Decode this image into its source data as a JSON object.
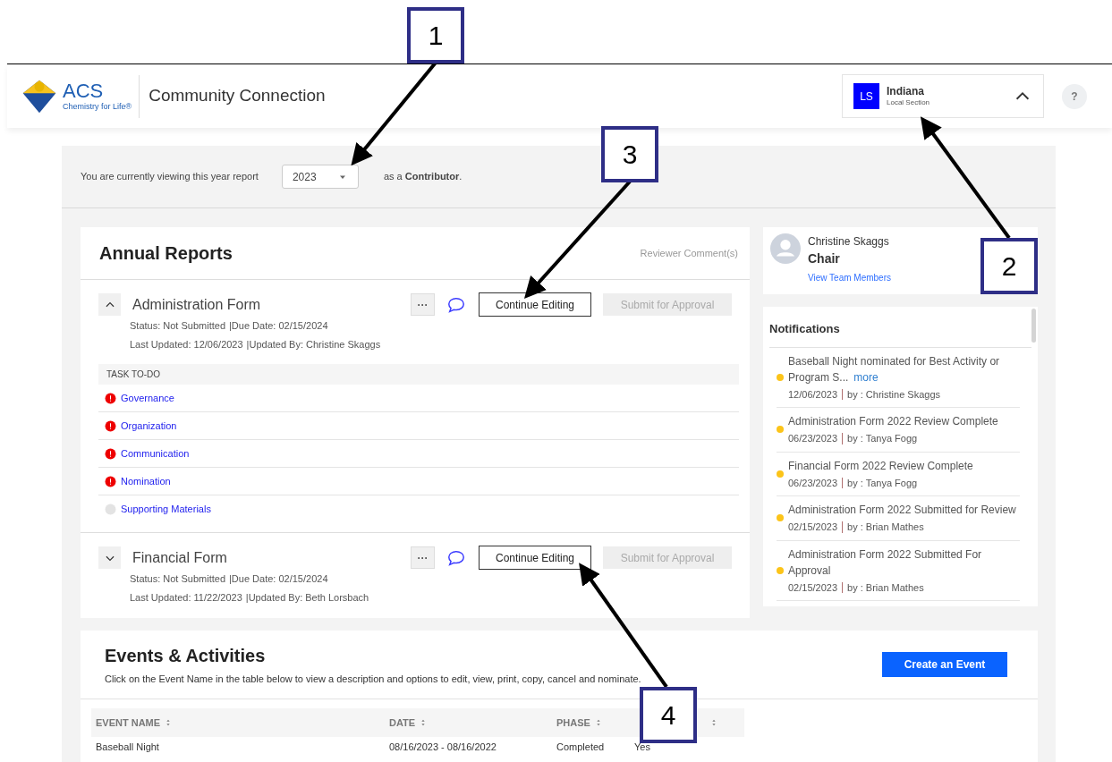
{
  "header": {
    "logo_text": "ACS",
    "logo_tagline": "Chemistry for Life®",
    "app_title": "Community Connection",
    "section": {
      "initials": "LS",
      "name": "Indiana",
      "type": "Local Section",
      "expanded": true
    },
    "help": "?"
  },
  "year_bar": {
    "lead": "You are currently viewing this year report",
    "year": "2023",
    "trail": "as a **Contributor**."
  },
  "annual_reports": {
    "title": "Annual Reports",
    "reviewer_link": "Reviewer Comment(s)",
    "forms": [
      {
        "name": "Administration Form",
        "expanded": true,
        "status": "Status: Not Submitted",
        "due": "|Due Date: 02/15/2024",
        "updated": "Last Updated: 12/06/2023",
        "updated_by": "|Updated By: Christine Skaggs",
        "more": "···",
        "edit": "Continue Editing",
        "submit": "Submit for Approval",
        "submit_disabled": true,
        "tasks_title": "TASK TO-DO",
        "tasks": [
          {
            "label": "Governance",
            "kind": "alert"
          },
          {
            "label": "Organization",
            "kind": "alert"
          },
          {
            "label": "Communication",
            "kind": "alert"
          },
          {
            "label": "Nomination",
            "kind": "alert"
          },
          {
            "label": "Supporting Materials",
            "kind": "empty"
          }
        ]
      },
      {
        "name": "Financial Form",
        "expanded": false,
        "status": "Status: Not Submitted",
        "due": "|Due Date: 02/15/2024",
        "updated": "Last Updated: 11/22/2023",
        "updated_by": "|Updated By: Beth Lorsbach",
        "more": "···",
        "edit": "Continue Editing",
        "submit": "Submit for Approval",
        "submit_disabled": true
      }
    ]
  },
  "profile": {
    "name": "Christine Skaggs",
    "role": "Chair",
    "link": "View Team Members"
  },
  "notifications": {
    "title": "Notifications",
    "items": [
      {
        "text": "Baseball Night nominated for Best Activity or Program S...",
        "more": "more",
        "date": "12/06/2023",
        "by": "by : Christine Skaggs",
        "color": "#fcc419"
      },
      {
        "text": "Administration Form 2022 Review Complete",
        "date": "06/23/2023",
        "by": "by : Tanya Fogg",
        "color": "#fcc419"
      },
      {
        "text": "Financial Form 2022 Review Complete",
        "date": "06/23/2023",
        "by": "by : Tanya Fogg",
        "color": "#fcc419"
      },
      {
        "text": "Administration Form 2022 Submitted for Review",
        "date": "02/15/2023",
        "by": "by : Brian Mathes",
        "color": "#fcc419"
      },
      {
        "text": "Administration Form 2022 Submitted For Approval",
        "date": "02/15/2023",
        "by": "by : Brian Mathes",
        "color": "#fcc419"
      }
    ]
  },
  "events": {
    "title": "Events & Activities",
    "description": "Click on the Event Name in the table below to view a description and options to edit, view, print, copy, cancel and nominate.",
    "create": "Create an Event",
    "columns": [
      {
        "label": "EVENT NAME"
      },
      {
        "label": "DATE"
      },
      {
        "label": "PHASE"
      },
      {}
    ],
    "rows": [
      [
        "Baseball Night",
        "08/16/2023 - 08/16/2022",
        "Completed",
        "Yes"
      ]
    ]
  },
  "callouts": [
    {
      "label": "1"
    },
    {
      "label": "2"
    },
    {
      "label": "3"
    },
    {
      "label": "4"
    }
  ]
}
